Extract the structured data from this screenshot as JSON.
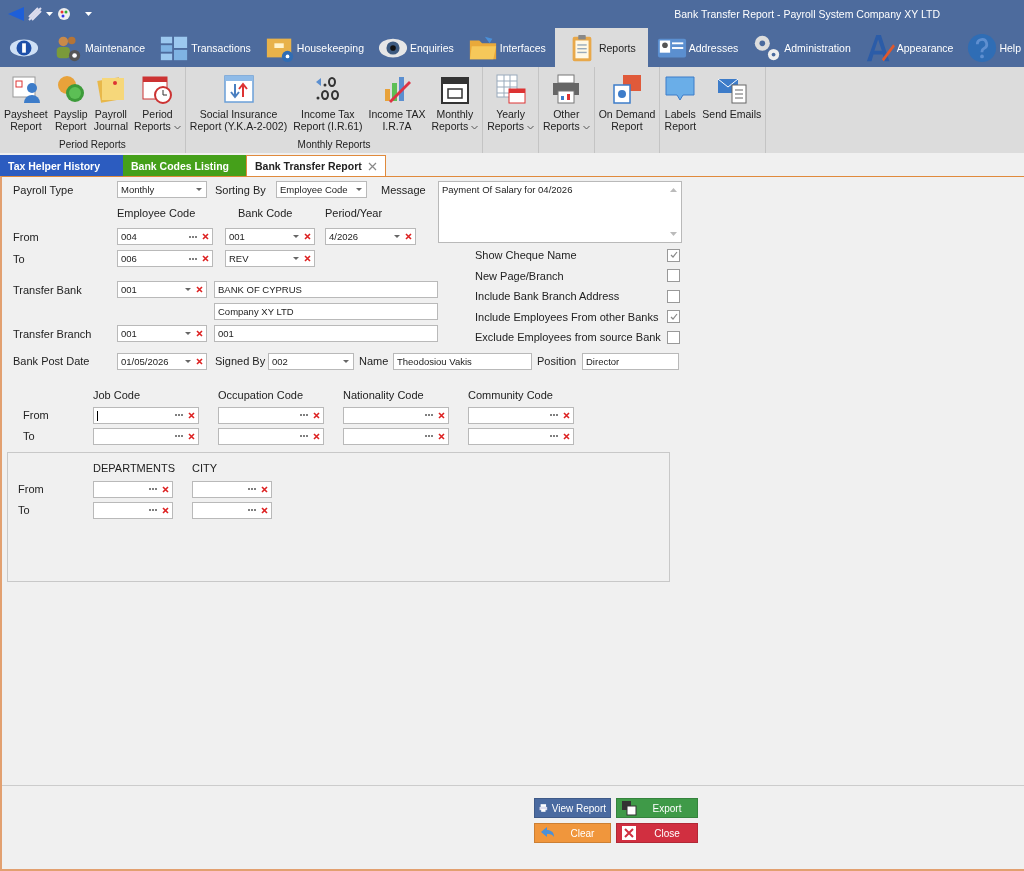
{
  "window": {
    "title": "Bank Transfer Report - Payroll System Company XY LTD"
  },
  "main_tabs": [
    {
      "kind": "logo",
      "selected": false
    },
    {
      "label": "Maintenance",
      "kind": "people",
      "selected": false
    },
    {
      "label": "Transactions",
      "kind": "blocks",
      "selected": false
    },
    {
      "label": "Housekeeping",
      "kind": "boxgear",
      "selected": false
    },
    {
      "label": "Enquiries",
      "kind": "eye",
      "selected": false
    },
    {
      "label": "Interfaces",
      "kind": "folder",
      "selected": false
    },
    {
      "label": "Reports",
      "kind": "clipboard",
      "selected": true
    },
    {
      "label": "Addresses",
      "kind": "card",
      "selected": false
    },
    {
      "label": "Administration",
      "kind": "gears",
      "selected": false
    },
    {
      "label": "Appearance",
      "kind": "letter",
      "selected": false
    },
    {
      "label": "Help",
      "kind": "help",
      "selected": false
    }
  ],
  "ribbon_groups": [
    {
      "label": "Period Reports",
      "buttons": [
        {
          "label": "Paysheet\nReport",
          "kind": "paysheet",
          "dropdown": false
        },
        {
          "label": "Payslip\nReport",
          "kind": "coins",
          "dropdown": false
        },
        {
          "label": "Payroll\nJournal",
          "kind": "notes",
          "dropdown": false
        },
        {
          "label": "Period\nReports",
          "kind": "calclock",
          "dropdown": true
        }
      ]
    },
    {
      "label": "Monthly Reports",
      "buttons": [
        {
          "label": "Social Insurance\nReport (Y.K.A-2-002)",
          "kind": "arrows",
          "dropdown": false
        },
        {
          "label": "Income Tax\nReport (I.R.61)",
          "kind": "decimal",
          "dropdown": false
        },
        {
          "label": "Income TAX\nI.R.7A",
          "kind": "chart",
          "dropdown": false
        },
        {
          "label": "Monthly\nReports",
          "kind": "calendar",
          "dropdown": true
        }
      ]
    },
    {
      "buttons": [
        {
          "label": "Yearly\nReports",
          "kind": "tablecal",
          "dropdown": true
        }
      ]
    },
    {
      "buttons": [
        {
          "label": "Other\nReports",
          "kind": "printer",
          "dropdown": true
        }
      ]
    },
    {
      "buttons": [
        {
          "label": "On Demand\nReport",
          "kind": "report",
          "dropdown": false
        }
      ]
    },
    {
      "buttons": [
        {
          "label": "Labels\nReport",
          "kind": "bubble",
          "dropdown": false
        },
        {
          "label": "Send Emails",
          "kind": "envelope",
          "dropdown": false
        }
      ]
    }
  ],
  "doc_tabs": [
    {
      "label": "Tax Helper History",
      "color": "#2c5cc0",
      "selected": false,
      "closable": false
    },
    {
      "label": "Bank Codes Listing",
      "color": "#45a01a",
      "selected": false,
      "closable": false
    },
    {
      "label": "Bank Transfer Report",
      "color": "#ffffff",
      "selected": true,
      "closable": true
    }
  ],
  "form": {
    "payroll_type": {
      "label": "Payroll Type",
      "value": "Monthly"
    },
    "sorting_by": {
      "label": "Sorting By",
      "value": "Employee Code"
    },
    "message": {
      "label": "Message",
      "value": "Payment Of Salary for 04/2026"
    },
    "range_labels": {
      "from": "From",
      "to": "To"
    },
    "ranges": [
      {
        "header": "Employee Code",
        "from": {
          "value": "004",
          "kind": "lookup"
        },
        "to": {
          "value": "006",
          "kind": "lookup"
        }
      },
      {
        "header": "Bank Code",
        "from": {
          "value": "001",
          "kind": "dropdown"
        },
        "to": {
          "value": "REV",
          "kind": "dropdown"
        }
      },
      {
        "header": "Period/Year",
        "from": {
          "value": "4/2026",
          "kind": "dropdown"
        }
      }
    ],
    "transfer_bank": {
      "label": "Transfer Bank",
      "code": "001",
      "name": "BANK OF CYPRUS",
      "company": "Company XY LTD"
    },
    "transfer_branch": {
      "label": "Transfer Branch",
      "code": "001",
      "name": "001"
    },
    "bank_post_date": {
      "label": "Bank Post Date",
      "value": "01/05/2026"
    },
    "signed_by": {
      "label": "Signed By",
      "value": "002"
    },
    "name": {
      "label": "Name",
      "value": "Theodosiou Vakis"
    },
    "position": {
      "label": "Position",
      "value": "Director"
    },
    "options": [
      {
        "label": "Show Cheque Name",
        "checked": true
      },
      {
        "label": "New Page/Branch",
        "checked": false
      },
      {
        "label": "Include Bank Branch Address",
        "checked": false
      },
      {
        "label": "Include Employees From other Banks",
        "checked": true
      },
      {
        "label": "Exclude Employees from source Bank",
        "checked": false
      }
    ],
    "filters": {
      "from": "From",
      "to": "To",
      "columns": [
        {
          "header": "Job Code",
          "focused": true
        },
        {
          "header": "Occupation Code",
          "focused": false
        },
        {
          "header": "Nationality Code",
          "focused": false
        },
        {
          "header": "Community Code",
          "focused": false
        }
      ]
    },
    "panel": {
      "from": "From",
      "to": "To",
      "columns": [
        {
          "header": "DEPARTMENTS"
        },
        {
          "header": "CITY"
        }
      ]
    }
  },
  "buttons": [
    {
      "label": "View Report",
      "kind": "view"
    },
    {
      "label": "Export",
      "kind": "export"
    },
    {
      "label": "Clear",
      "kind": "clear"
    },
    {
      "label": "Close",
      "kind": "close"
    }
  ]
}
